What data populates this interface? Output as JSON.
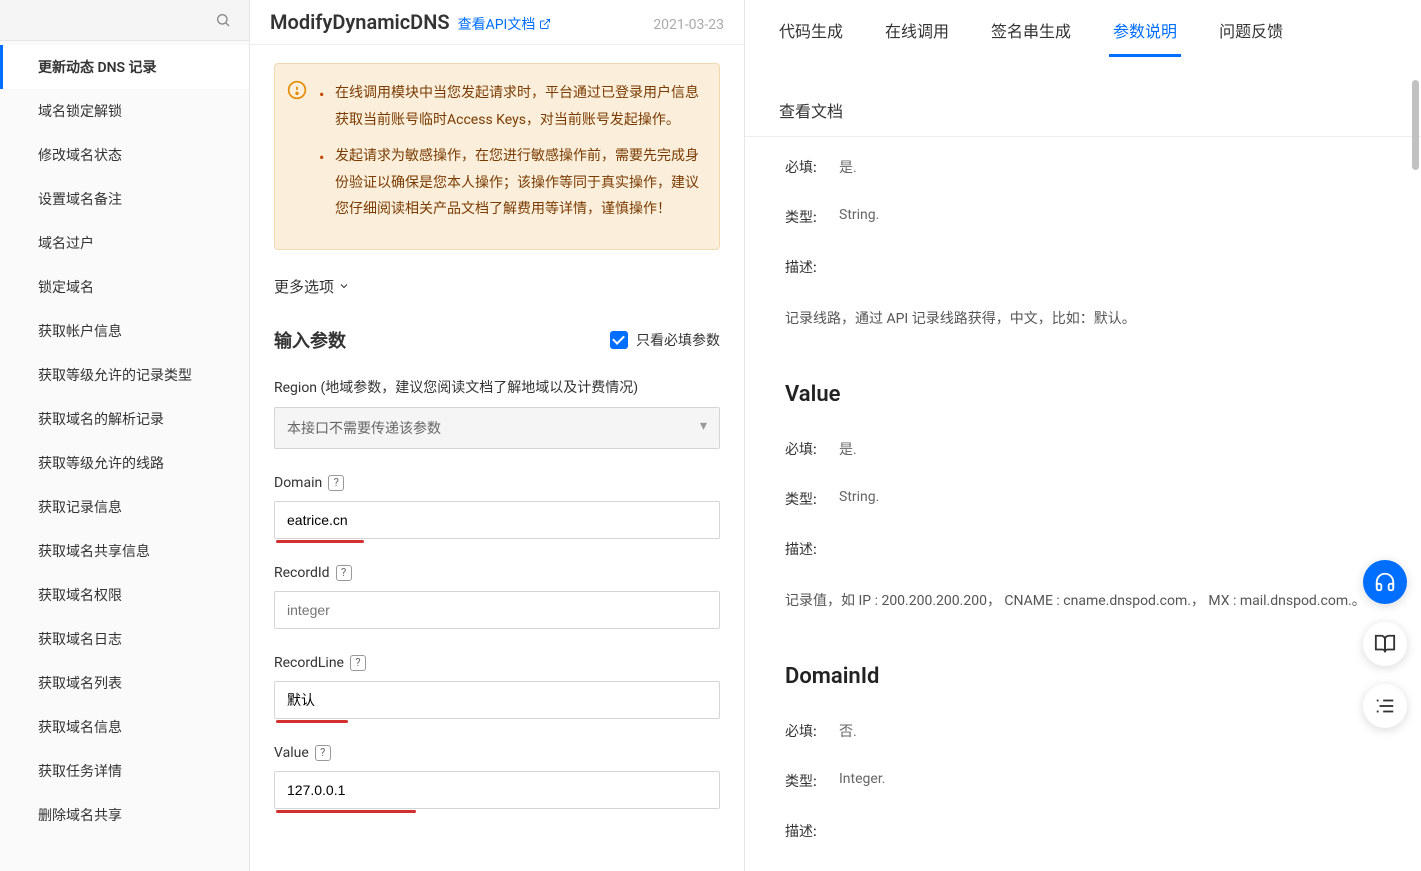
{
  "sidebar": {
    "search_placeholder": "",
    "items": [
      {
        "label": "更新动态 DNS 记录",
        "active": true
      },
      {
        "label": "域名锁定解锁"
      },
      {
        "label": "修改域名状态"
      },
      {
        "label": "设置域名备注"
      },
      {
        "label": "域名过户"
      },
      {
        "label": "锁定域名"
      },
      {
        "label": "获取帐户信息"
      },
      {
        "label": "获取等级允许的记录类型"
      },
      {
        "label": "获取域名的解析记录"
      },
      {
        "label": "获取等级允许的线路"
      },
      {
        "label": "获取记录信息"
      },
      {
        "label": "获取域名共享信息"
      },
      {
        "label": "获取域名权限"
      },
      {
        "label": "获取域名日志"
      },
      {
        "label": "获取域名列表"
      },
      {
        "label": "获取域名信息"
      },
      {
        "label": "获取任务详情"
      },
      {
        "label": "删除域名共享"
      }
    ]
  },
  "mid": {
    "title": "ModifyDynamicDNS",
    "doc_link": "查看API文档",
    "date": "2021-03-23",
    "warning": [
      "在线调用模块中当您发起请求时，平台通过已登录用户信息获取当前账号临时Access Keys，对当前账号发起操作。",
      "发起请求为敏感操作，在您进行敏感操作前，需要先完成身份验证以确保是您本人操作；该操作等同于真实操作，建议您仔细阅读相关产品文档了解费用等详情，谨慎操作！"
    ],
    "more_options": "更多选项",
    "param_title": "输入参数",
    "required_only": "只看必填参数",
    "region_label": "Region (地域参数，建议您阅读文档了解地域以及计费情况)",
    "region_value": "本接口不需要传递该参数",
    "fields": {
      "domain_label": "Domain",
      "domain_value": "eatrice.cn",
      "recordid_label": "RecordId",
      "recordid_placeholder": "integer",
      "recordline_label": "RecordLine",
      "recordline_value": "默认",
      "value_label": "Value",
      "value_value": "127.0.0.1"
    }
  },
  "right": {
    "tabs": [
      "代码生成",
      "在线调用",
      "签名串生成",
      "参数说明",
      "问题反馈",
      "查看文档"
    ],
    "active_tab": 3,
    "sections": [
      {
        "required_label": "必填:",
        "required_val": "是.",
        "type_label": "类型:",
        "type_val": "String.",
        "desc_label": "描述:",
        "desc_val": "记录线路，通过 API 记录线路获得，中文，比如：默认。"
      },
      {
        "title": "Value",
        "required_label": "必填:",
        "required_val": "是.",
        "type_label": "类型:",
        "type_val": "String.",
        "desc_label": "描述:",
        "desc_val": "记录值，如 IP : 200.200.200.200， CNAME : cname.dnspod.com.， MX : mail.dnspod.com.。"
      },
      {
        "title": "DomainId",
        "required_label": "必填:",
        "required_val": "否.",
        "type_label": "类型:",
        "type_val": "Integer.",
        "desc_label": "描述:"
      }
    ]
  }
}
